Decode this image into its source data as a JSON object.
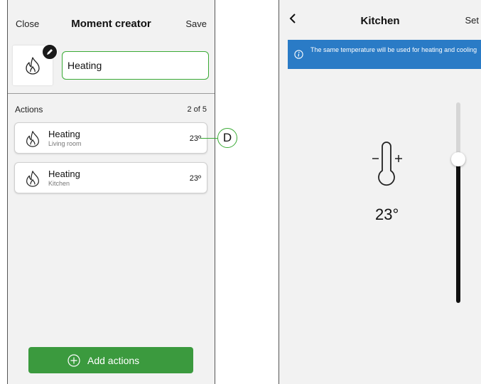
{
  "left_screen": {
    "close_label": "Close",
    "title": "Moment creator",
    "save_label": "Save",
    "moment_icon": "flame-icon",
    "edit_icon": "pencil-icon",
    "name_value": "Heating",
    "actions_label": "Actions",
    "actions_count": "2 of 5",
    "actions": [
      {
        "title": "Heating",
        "subtitle": "Living room",
        "value": "23º",
        "icon": "flame-icon"
      },
      {
        "title": "Heating",
        "subtitle": "Kitchen",
        "value": "23º",
        "icon": "flame-icon"
      }
    ],
    "callout_label": "D",
    "add_actions_label": "Add actions",
    "accent_color": "#3aaa35",
    "button_color": "#3b9a3e"
  },
  "right_screen": {
    "title": "Kitchen",
    "set_label": "Set",
    "back_icon": "chevron-left-icon",
    "info_text": "The same temperature will be used for heating and cooling",
    "info_icon": "info-icon",
    "banner_color": "#2a7bc6",
    "thermometer_icon": "thermometer-icon",
    "temperature": "23°",
    "slider_level_percent": 71
  }
}
